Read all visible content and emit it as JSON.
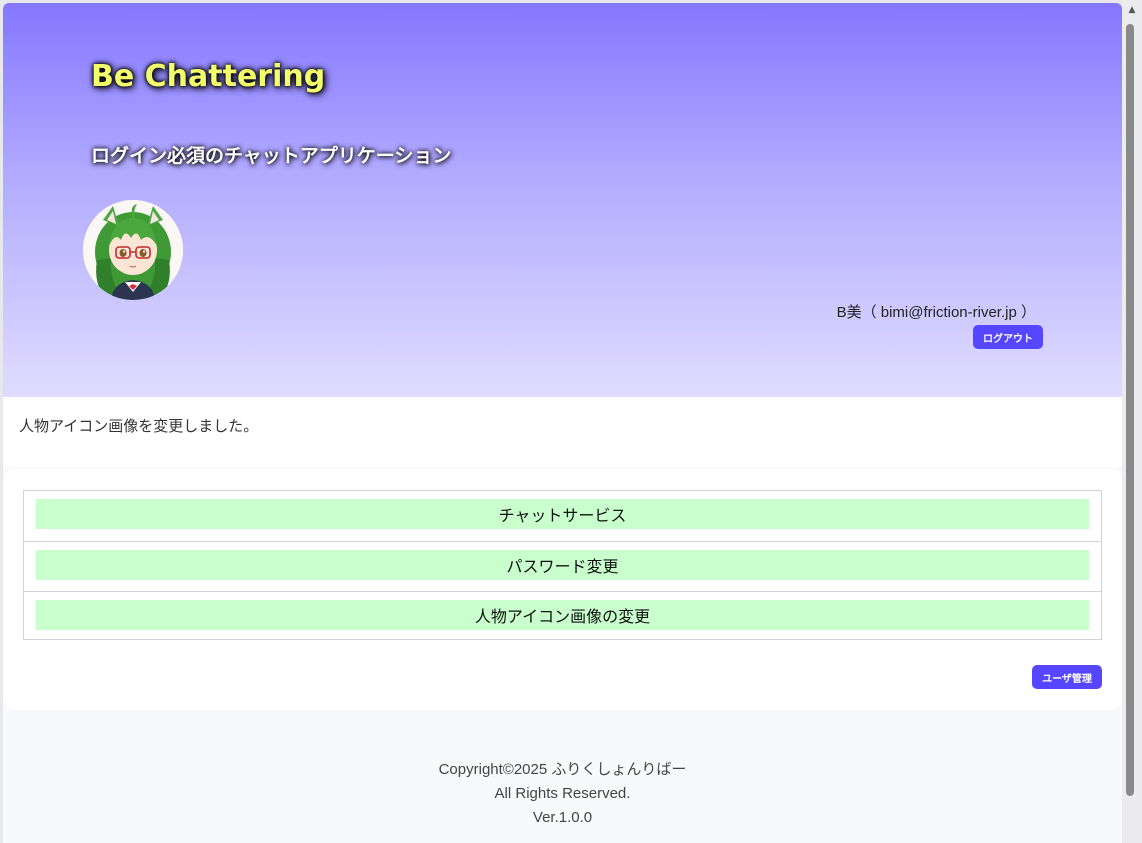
{
  "header": {
    "title": "Be Chattering",
    "subtitle": "ログイン必須のチャットアプリケーション",
    "user_info": "B美（ bimi@friction-river.jp ）",
    "logout_label": "ログアウト"
  },
  "flash": {
    "message": "人物アイコン画像を変更しました。"
  },
  "menu": {
    "items": [
      {
        "label": "チャットサービス"
      },
      {
        "label": "パスワード変更"
      },
      {
        "label": "人物アイコン画像の変更"
      }
    ],
    "admin_label": "ユーザ管理"
  },
  "footer": {
    "copyright": "Copyright©2025 ふりくしょんりばー",
    "rights": "All Rights Reserved.",
    "version": "Ver.1.0.0"
  },
  "colors": {
    "header_gradient_top": "#8477ff",
    "header_gradient_bottom": "#e0dcff",
    "title_color": "#f3ff6a",
    "button_bg": "#5646ff",
    "menu_item_bg": "#c8ffcc"
  },
  "icons": {
    "avatar": "avatar-image",
    "scroll_up": "scroll-up-arrow-icon"
  }
}
